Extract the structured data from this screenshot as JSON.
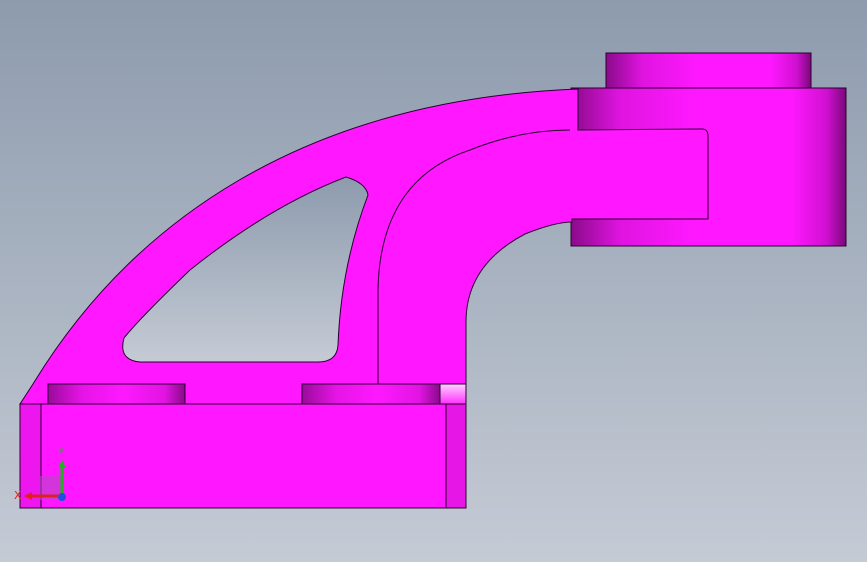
{
  "viewport": {
    "background_top": "#8d9bad",
    "background_bottom": "#c5cbd5"
  },
  "model": {
    "part_color": "#ff18ff",
    "shade_dark": "#8a0a8a",
    "shade_mid": "#c812c8",
    "highlight": "#ffb0ff",
    "edge_color": "#2a0030"
  },
  "triad": {
    "x_label": "X",
    "y_label": "Y",
    "x_color": "#e02020",
    "y_color": "#20b020",
    "z_color": "#2050e0"
  }
}
